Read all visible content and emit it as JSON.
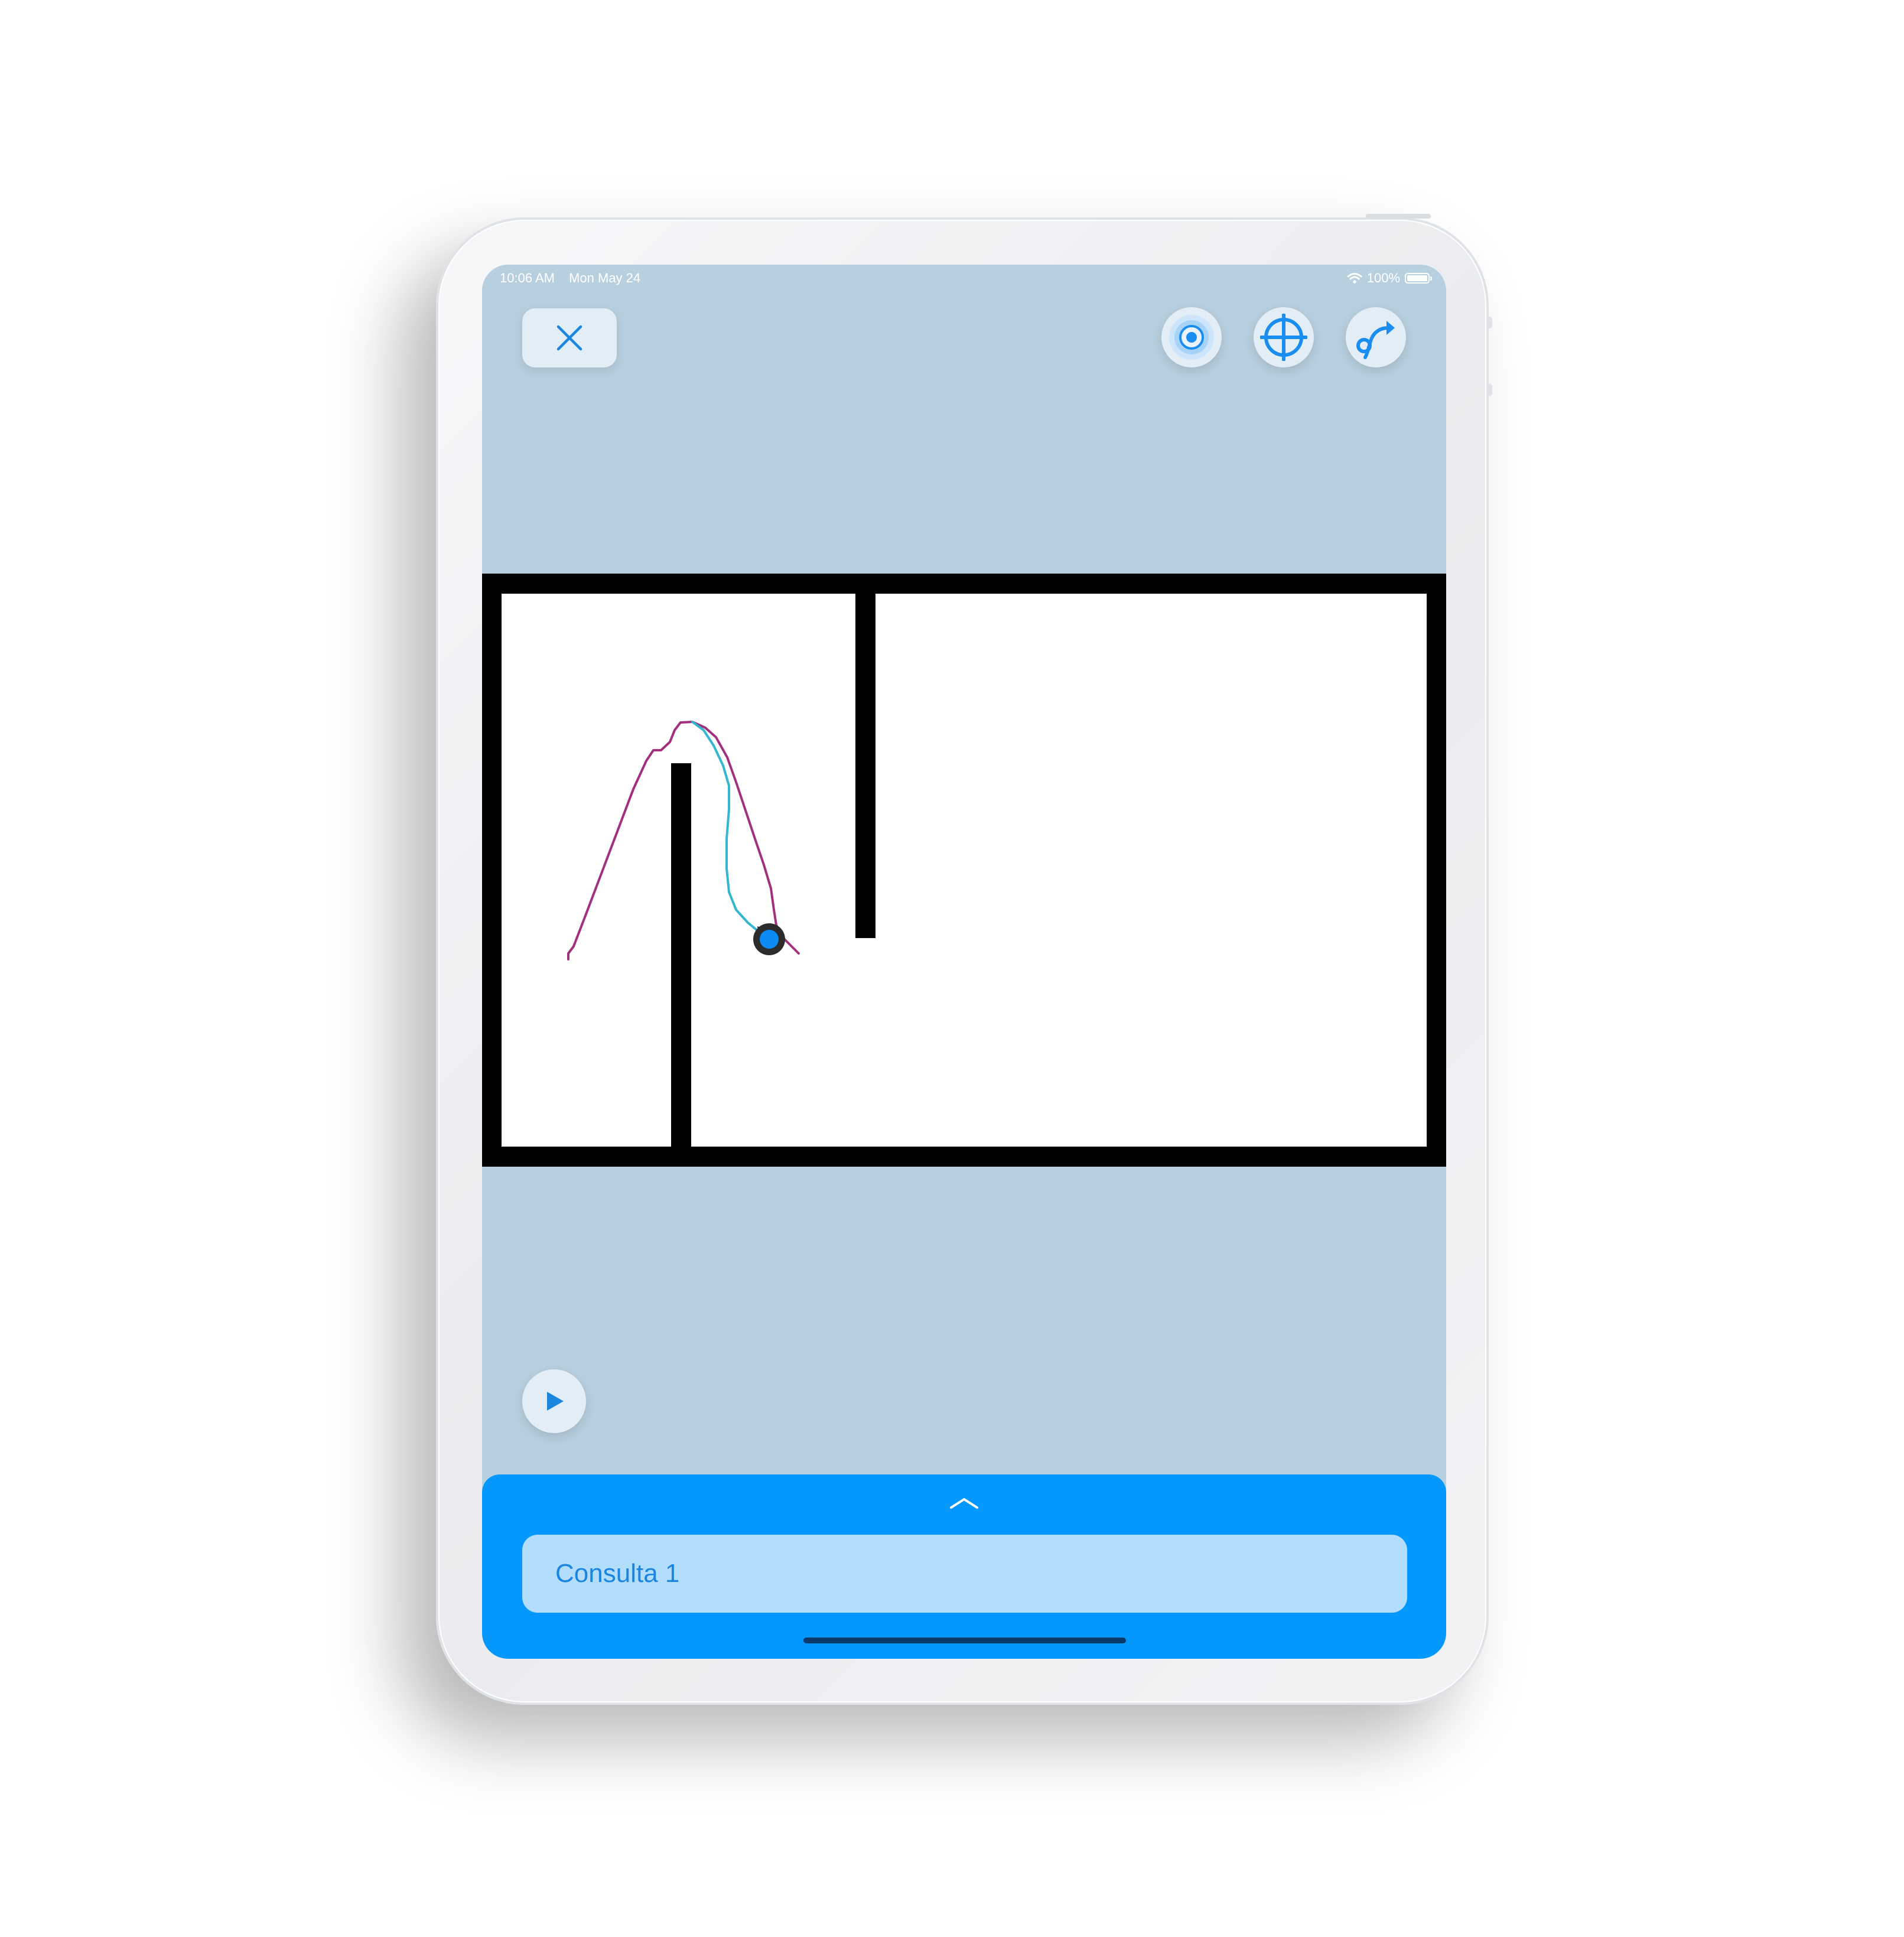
{
  "status_bar": {
    "time": "10:06 AM",
    "date": "Mon May 24",
    "battery": "100%",
    "icons": [
      "wifi-icon",
      "battery-icon"
    ]
  },
  "toolbar": {
    "close_icon": "close-icon",
    "actions": [
      {
        "name": "beacon-button",
        "icon": "target-rings-icon"
      },
      {
        "name": "crosshair-button",
        "icon": "crosshair-icon"
      },
      {
        "name": "route-button",
        "icon": "route-arrow-icon"
      }
    ]
  },
  "map": {
    "trace_colors": {
      "magenta": "#a3307f",
      "cyan": "#33b6cf"
    },
    "position_marker_color": "#0a8bf5"
  },
  "player": {
    "play_icon": "play-icon"
  },
  "sheet": {
    "expand_icon": "chevron-up-icon",
    "search_value": "Consulta 1"
  },
  "colors": {
    "screen_bg": "#b8cfdf",
    "accent": "#0497fd",
    "button_bg": "#e3edf5",
    "search_bg": "#b3ddfc",
    "search_text": "#1a86e0"
  }
}
